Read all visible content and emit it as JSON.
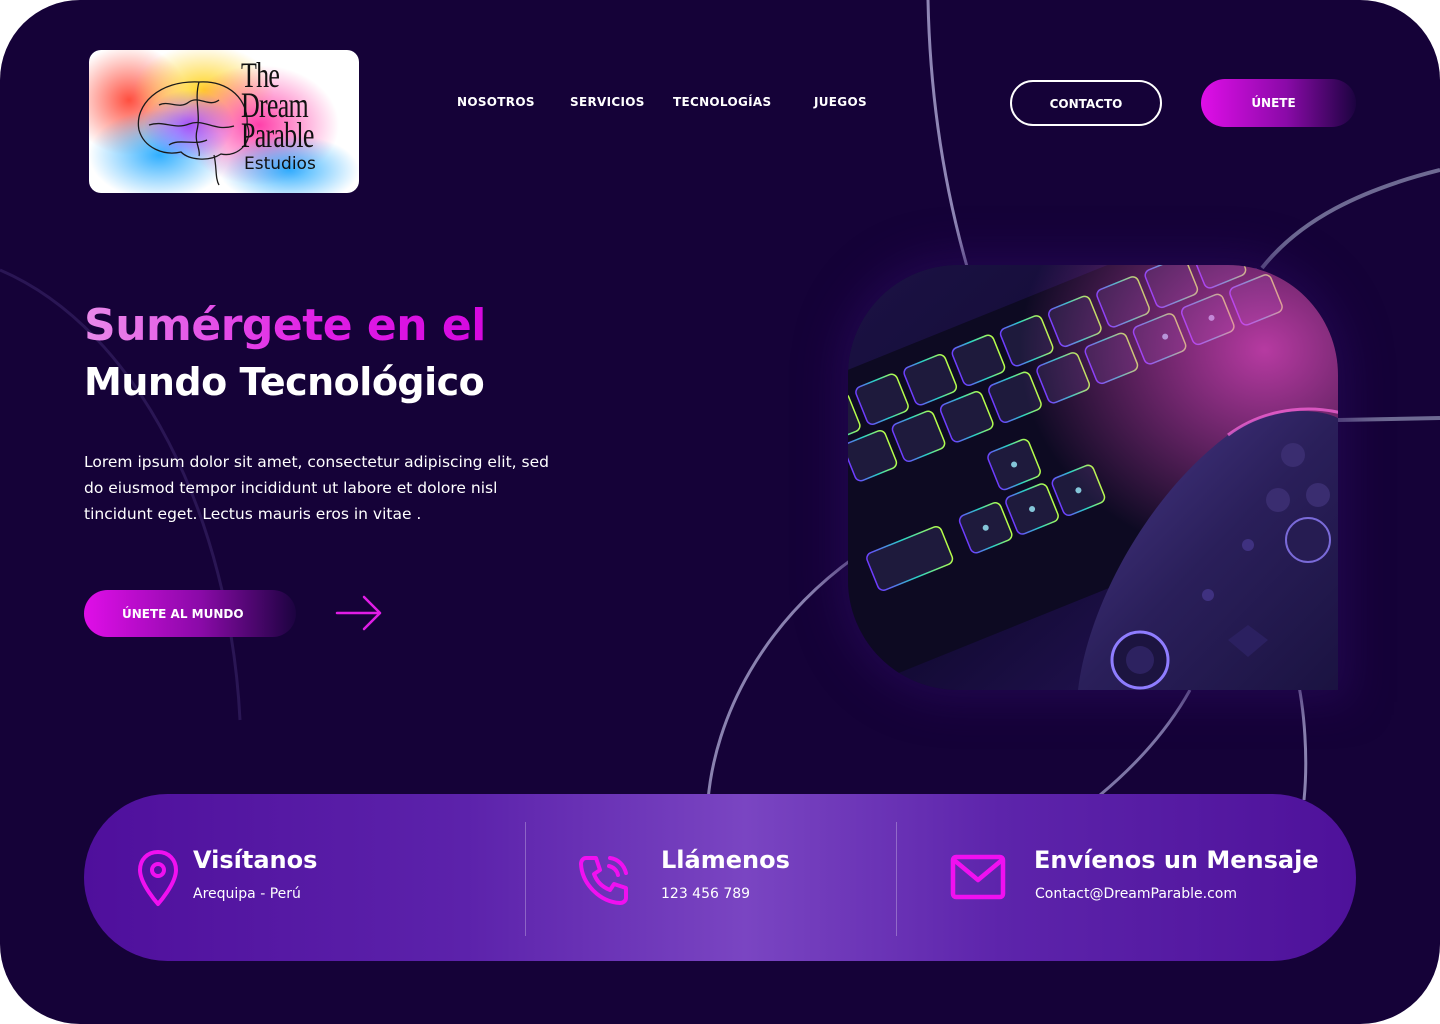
{
  "logo": {
    "line1": "The",
    "line2": "Dream",
    "line3": "Parable",
    "sub": "Estudios"
  },
  "nav": {
    "items": [
      {
        "label": "NOSOTROS"
      },
      {
        "label": "SERVICIOS"
      },
      {
        "label": "TECNOLOGÍAS"
      },
      {
        "label": "JUEGOS"
      }
    ],
    "contact_label": "CONTACTO",
    "join_label": "ÚNETE"
  },
  "hero": {
    "title_line1": "Sumérgete en el",
    "title_line2": "Mundo Tecnológico",
    "paragraph": "Lorem ipsum dolor sit amet, consectetur adipiscing elit, sed do eiusmod tempor incididunt ut labore et dolore nisl tincidunt eget. Lectus mauris eros in vitae .",
    "cta_label": "ÚNETE AL MUNDO"
  },
  "contact": {
    "visit": {
      "title": "Visítanos",
      "value": "Arequipa - Perú"
    },
    "call": {
      "title": "Llámenos",
      "value": "123 456 789"
    },
    "mail": {
      "title": "Envíenos un Mensaje",
      "value": "Contact@DreamParable.com"
    }
  },
  "icons": {
    "location": "location-pin-icon",
    "phone": "phone-icon",
    "mail": "mail-icon",
    "arrow": "arrow-right-icon"
  },
  "colors": {
    "background": "#150238",
    "accent": "#e00ee8",
    "band": "#5c22ab"
  }
}
